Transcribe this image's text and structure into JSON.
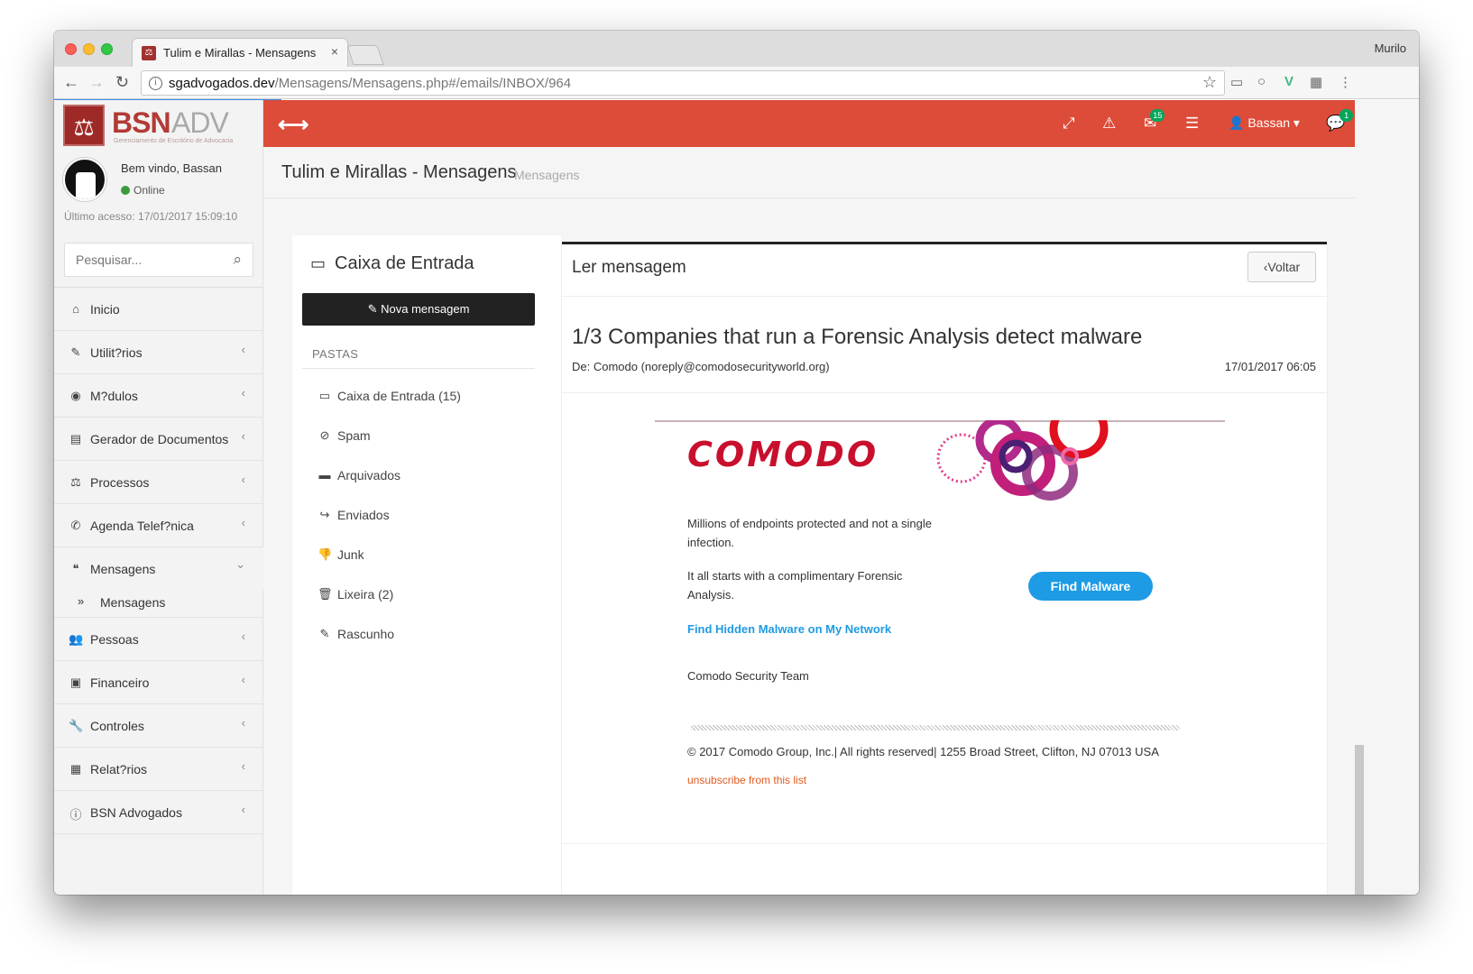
{
  "browser": {
    "tab_title": "Tulim e Mirallas - Mensagens",
    "tab_close": "×",
    "profile_name": "Murilo",
    "url_host": "sgadvogados.dev",
    "url_path": "/Mensagens/Mensagens.php#/emails/INBOX/964"
  },
  "logo": {
    "brand": "BSN",
    "suffix": "ADV",
    "tagline": "Gerenciamento de Escritório de Advocacia"
  },
  "user_panel": {
    "welcome": "Bem vindo, Bassan",
    "status": "Online",
    "last_access": "Último acesso: 17/01/2017 15:09:10"
  },
  "search": {
    "placeholder": "Pesquisar..."
  },
  "sidebar": {
    "items": [
      {
        "label": "Inicio",
        "icon": "home-icon"
      },
      {
        "label": "Utilit?rios",
        "icon": "magic-icon"
      },
      {
        "label": "M?dulos",
        "icon": "user-circle-icon"
      },
      {
        "label": "Gerador de Documentos",
        "icon": "document-icon"
      },
      {
        "label": "Processos",
        "icon": "balance-scale-icon"
      },
      {
        "label": "Agenda Telef?nica",
        "icon": "phone-icon"
      },
      {
        "label": "Mensagens",
        "icon": "comments-icon"
      },
      {
        "label": "Pessoas",
        "icon": "users-icon"
      },
      {
        "label": "Financeiro",
        "icon": "money-icon"
      },
      {
        "label": "Controles",
        "icon": "wrench-icon"
      },
      {
        "label": "Relat?rios",
        "icon": "table-icon"
      },
      {
        "label": "BSN Advogados",
        "icon": "info-circle-icon"
      }
    ],
    "submenu_mensagens": "Mensagens"
  },
  "topbar": {
    "mail_badge": "15",
    "chat_badge": "1",
    "user_name": "Bassan",
    "accent": "#dd4b39"
  },
  "header": {
    "title": "Tulim e Mirallas - Mensagens",
    "subtitle": "Mensagens"
  },
  "mailbox": {
    "title": "Caixa de Entrada",
    "new_button": "Nova mensagem",
    "folders_heading": "PASTAS",
    "folders": [
      {
        "label": "Caixa de Entrada (15)",
        "icon": "inbox-icon"
      },
      {
        "label": "Spam",
        "icon": "ban-icon"
      },
      {
        "label": "Arquivados",
        "icon": "archive-icon"
      },
      {
        "label": "Enviados",
        "icon": "share-icon"
      },
      {
        "label": "Junk",
        "icon": "thumbs-down-icon"
      },
      {
        "label": "Lixeira (2)",
        "icon": "trash-icon"
      },
      {
        "label": "Rascunho",
        "icon": "edit-icon"
      }
    ]
  },
  "message": {
    "panel_title": "Ler mensagem",
    "back_button": "Voltar",
    "subject": "1/3 Companies that run a Forensic Analysis detect malware",
    "from": "De: Comodo (noreply@comodosecurityworld.org)",
    "date": "17/01/2017 06:05"
  },
  "email_body": {
    "brand": "COMODO",
    "para1": "Millions of endpoints protected and not a single infection.",
    "para2": "It all starts with a complimentary Forensic Analysis.",
    "cta_button": "Find Malware",
    "link": "Find Hidden Malware on My Network",
    "signature": "Comodo Security Team",
    "copyright": "© 2017 Comodo Group, Inc.| All rights reserved| 1255 Broad Street, Clifton, NJ 07013 USA",
    "unsubscribe": "unsubscribe from this list",
    "brand_color": "#c8102e",
    "cta_color": "#1e9be5"
  }
}
